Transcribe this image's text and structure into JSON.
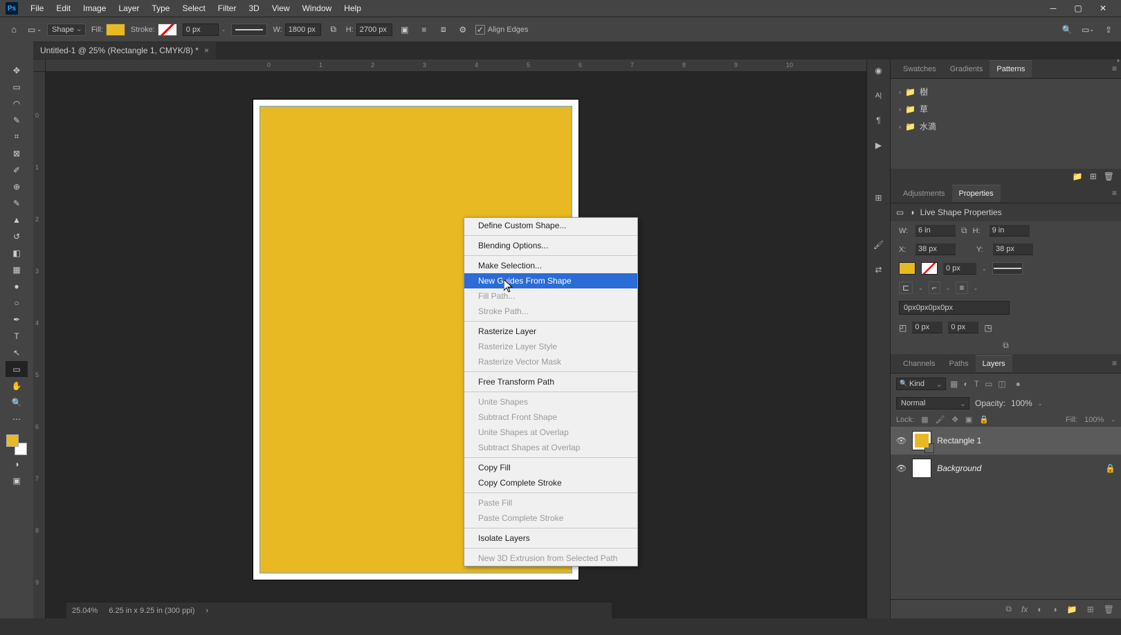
{
  "menubar": {
    "items": [
      "File",
      "Edit",
      "Image",
      "Layer",
      "Type",
      "Select",
      "Filter",
      "3D",
      "View",
      "Window",
      "Help"
    ]
  },
  "optionsbar": {
    "shape_mode": "Shape",
    "fill_label": "Fill:",
    "fill_color": "#e8b923",
    "stroke_label": "Stroke:",
    "stroke_width": "0 px",
    "w_label": "W:",
    "w_value": "1800 px",
    "h_label": "H:",
    "h_value": "2700 px",
    "align_edges_label": "Align Edges"
  },
  "document": {
    "tab_title": "Untitled-1 @ 25% (Rectangle 1, CMYK/8) *"
  },
  "ruler_h": [
    "0",
    "1",
    "2",
    "3",
    "4",
    "5",
    "6",
    "7",
    "8",
    "9",
    "10"
  ],
  "ruler_v": [
    "0",
    "1",
    "2",
    "3",
    "4",
    "5",
    "6",
    "7",
    "8",
    "9"
  ],
  "context_menu": {
    "items": [
      {
        "label": "Define Custom Shape...",
        "state": "normal"
      },
      {
        "sep": true
      },
      {
        "label": "Blending Options...",
        "state": "normal"
      },
      {
        "sep": true
      },
      {
        "label": "Make Selection...",
        "state": "normal"
      },
      {
        "label": "New Guides From Shape",
        "state": "highlight"
      },
      {
        "label": "Fill Path...",
        "state": "disabled"
      },
      {
        "label": "Stroke Path...",
        "state": "disabled"
      },
      {
        "sep": true
      },
      {
        "label": "Rasterize Layer",
        "state": "normal"
      },
      {
        "label": "Rasterize Layer Style",
        "state": "disabled"
      },
      {
        "label": "Rasterize Vector Mask",
        "state": "disabled"
      },
      {
        "sep": true
      },
      {
        "label": "Free Transform Path",
        "state": "normal"
      },
      {
        "sep": true
      },
      {
        "label": "Unite Shapes",
        "state": "disabled"
      },
      {
        "label": "Subtract Front Shape",
        "state": "disabled"
      },
      {
        "label": "Unite Shapes at Overlap",
        "state": "disabled"
      },
      {
        "label": "Subtract Shapes at Overlap",
        "state": "disabled"
      },
      {
        "sep": true
      },
      {
        "label": "Copy Fill",
        "state": "normal"
      },
      {
        "label": "Copy Complete Stroke",
        "state": "normal"
      },
      {
        "sep": true
      },
      {
        "label": "Paste Fill",
        "state": "disabled"
      },
      {
        "label": "Paste Complete Stroke",
        "state": "disabled"
      },
      {
        "sep": true
      },
      {
        "label": "Isolate Layers",
        "state": "normal"
      },
      {
        "sep": true
      },
      {
        "label": "New 3D Extrusion from Selected Path",
        "state": "disabled"
      }
    ]
  },
  "patterns": {
    "tab_swatches": "Swatches",
    "tab_gradients": "Gradients",
    "tab_patterns": "Patterns",
    "folders": [
      "樹",
      "草",
      "水滴"
    ]
  },
  "properties": {
    "tab_adjustments": "Adjustments",
    "tab_properties": "Properties",
    "header": "Live Shape Properties",
    "w_label": "W:",
    "w_value": "6 in",
    "h_label": "H:",
    "h_value": "9 in",
    "x_label": "X:",
    "x_value": "38 px",
    "y_label": "Y:",
    "y_value": "38 px",
    "stroke_width": "0 px",
    "radii": "0px0px0px0px",
    "r1": "0 px",
    "r2": "0 px"
  },
  "layers": {
    "tab_channels": "Channels",
    "tab_paths": "Paths",
    "tab_layers": "Layers",
    "filter_kind": "Kind",
    "blend_mode": "Normal",
    "opacity_label": "Opacity:",
    "opacity_value": "100%",
    "lock_label": "Lock:",
    "fill_label": "Fill:",
    "fill_value": "100%",
    "items": [
      {
        "name": "Rectangle 1",
        "italic": false
      },
      {
        "name": "Background",
        "italic": true
      }
    ]
  },
  "status": {
    "zoom": "25.04%",
    "docinfo": "6.25 in x 9.25 in (300 ppi)"
  }
}
